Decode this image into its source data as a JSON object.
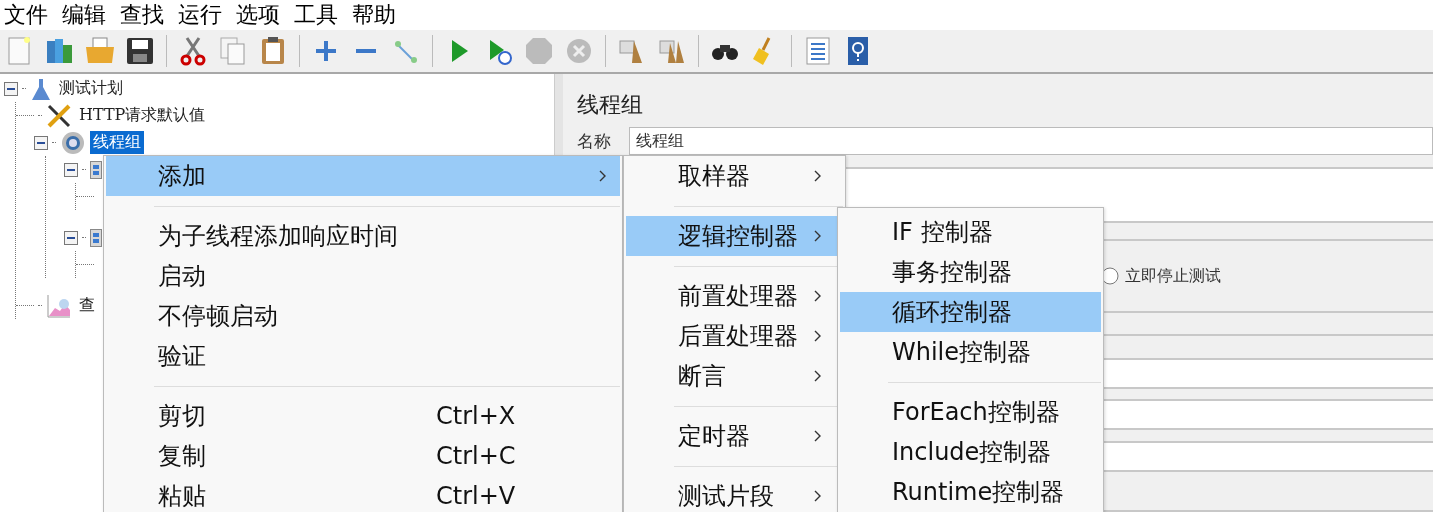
{
  "menubar": [
    {
      "label": "文件"
    },
    {
      "label": "编辑"
    },
    {
      "label": "查找"
    },
    {
      "label": "运行"
    },
    {
      "label": "选项"
    },
    {
      "label": "工具"
    },
    {
      "label": "帮助"
    }
  ],
  "tree": [
    {
      "label": "测试计划",
      "kind": "plan",
      "expanded": true,
      "selected": false,
      "children": [
        {
          "label": "HTTP请求默认值",
          "kind": "config",
          "selected": false
        },
        {
          "label": "线程组",
          "kind": "threads",
          "expanded": true,
          "selected": true,
          "children": [
            {
              "kind": "controller",
              "expanded": true,
              "selected": false
            },
            {
              "kind": "controller",
              "expanded": true,
              "selected": false
            }
          ]
        },
        {
          "label": "查",
          "kind": "listener",
          "selected": false
        }
      ]
    }
  ],
  "panel": {
    "title": "线程组",
    "name_label": "名称",
    "name_value": "线程组",
    "radio": {
      "label": "立即停止测试",
      "selected": false
    }
  },
  "menus": [
    {
      "items": [
        {
          "kind": "item",
          "label": "添加",
          "selected": true,
          "submenu": true
        },
        {
          "kind": "separator"
        },
        {
          "kind": "item",
          "label": "为子线程添加响应时间",
          "selected": false,
          "submenu": false
        },
        {
          "kind": "item",
          "label": "启动",
          "selected": false,
          "submenu": false
        },
        {
          "kind": "item",
          "label": "不停顿启动",
          "selected": false,
          "submenu": false
        },
        {
          "kind": "item",
          "label": "验证",
          "selected": false,
          "submenu": false
        },
        {
          "kind": "separator"
        },
        {
          "kind": "item",
          "label": "剪切",
          "shortcut": "Ctrl+X",
          "selected": false,
          "submenu": false
        },
        {
          "kind": "item",
          "label": "复制",
          "shortcut": "Ctrl+C",
          "selected": false,
          "submenu": false
        },
        {
          "kind": "item",
          "label": "粘贴",
          "shortcut": "Ctrl+V",
          "selected": false,
          "submenu": false
        }
      ]
    },
    {
      "items": [
        {
          "kind": "item",
          "label": "取样器",
          "selected": false,
          "submenu": true
        },
        {
          "kind": "separator"
        },
        {
          "kind": "item",
          "label": "逻辑控制器",
          "selected": true,
          "submenu": true
        },
        {
          "kind": "separator"
        },
        {
          "kind": "item",
          "label": "前置处理器",
          "selected": false,
          "submenu": true
        },
        {
          "kind": "item",
          "label": "后置处理器",
          "selected": false,
          "submenu": true
        },
        {
          "kind": "item",
          "label": "断言",
          "selected": false,
          "submenu": true
        },
        {
          "kind": "separator"
        },
        {
          "kind": "item",
          "label": "定时器",
          "selected": false,
          "submenu": true
        },
        {
          "kind": "separator"
        },
        {
          "kind": "item",
          "label": "测试片段",
          "selected": false,
          "submenu": true
        }
      ]
    },
    {
      "items": [
        {
          "kind": "item",
          "label": "IF 控制器",
          "selected": false,
          "submenu": false
        },
        {
          "kind": "item",
          "label": "事务控制器",
          "selected": false,
          "submenu": false
        },
        {
          "kind": "item",
          "label": "循环控制器",
          "selected": true,
          "submenu": false
        },
        {
          "kind": "item",
          "label": "While控制器",
          "selected": false,
          "submenu": false
        },
        {
          "kind": "separator"
        },
        {
          "kind": "item",
          "label": "ForEach控制器",
          "selected": false,
          "submenu": false
        },
        {
          "kind": "item",
          "label": "Include控制器",
          "selected": false,
          "submenu": false
        },
        {
          "kind": "item",
          "label": "Runtime控制器",
          "selected": false,
          "submenu": false
        }
      ]
    }
  ]
}
